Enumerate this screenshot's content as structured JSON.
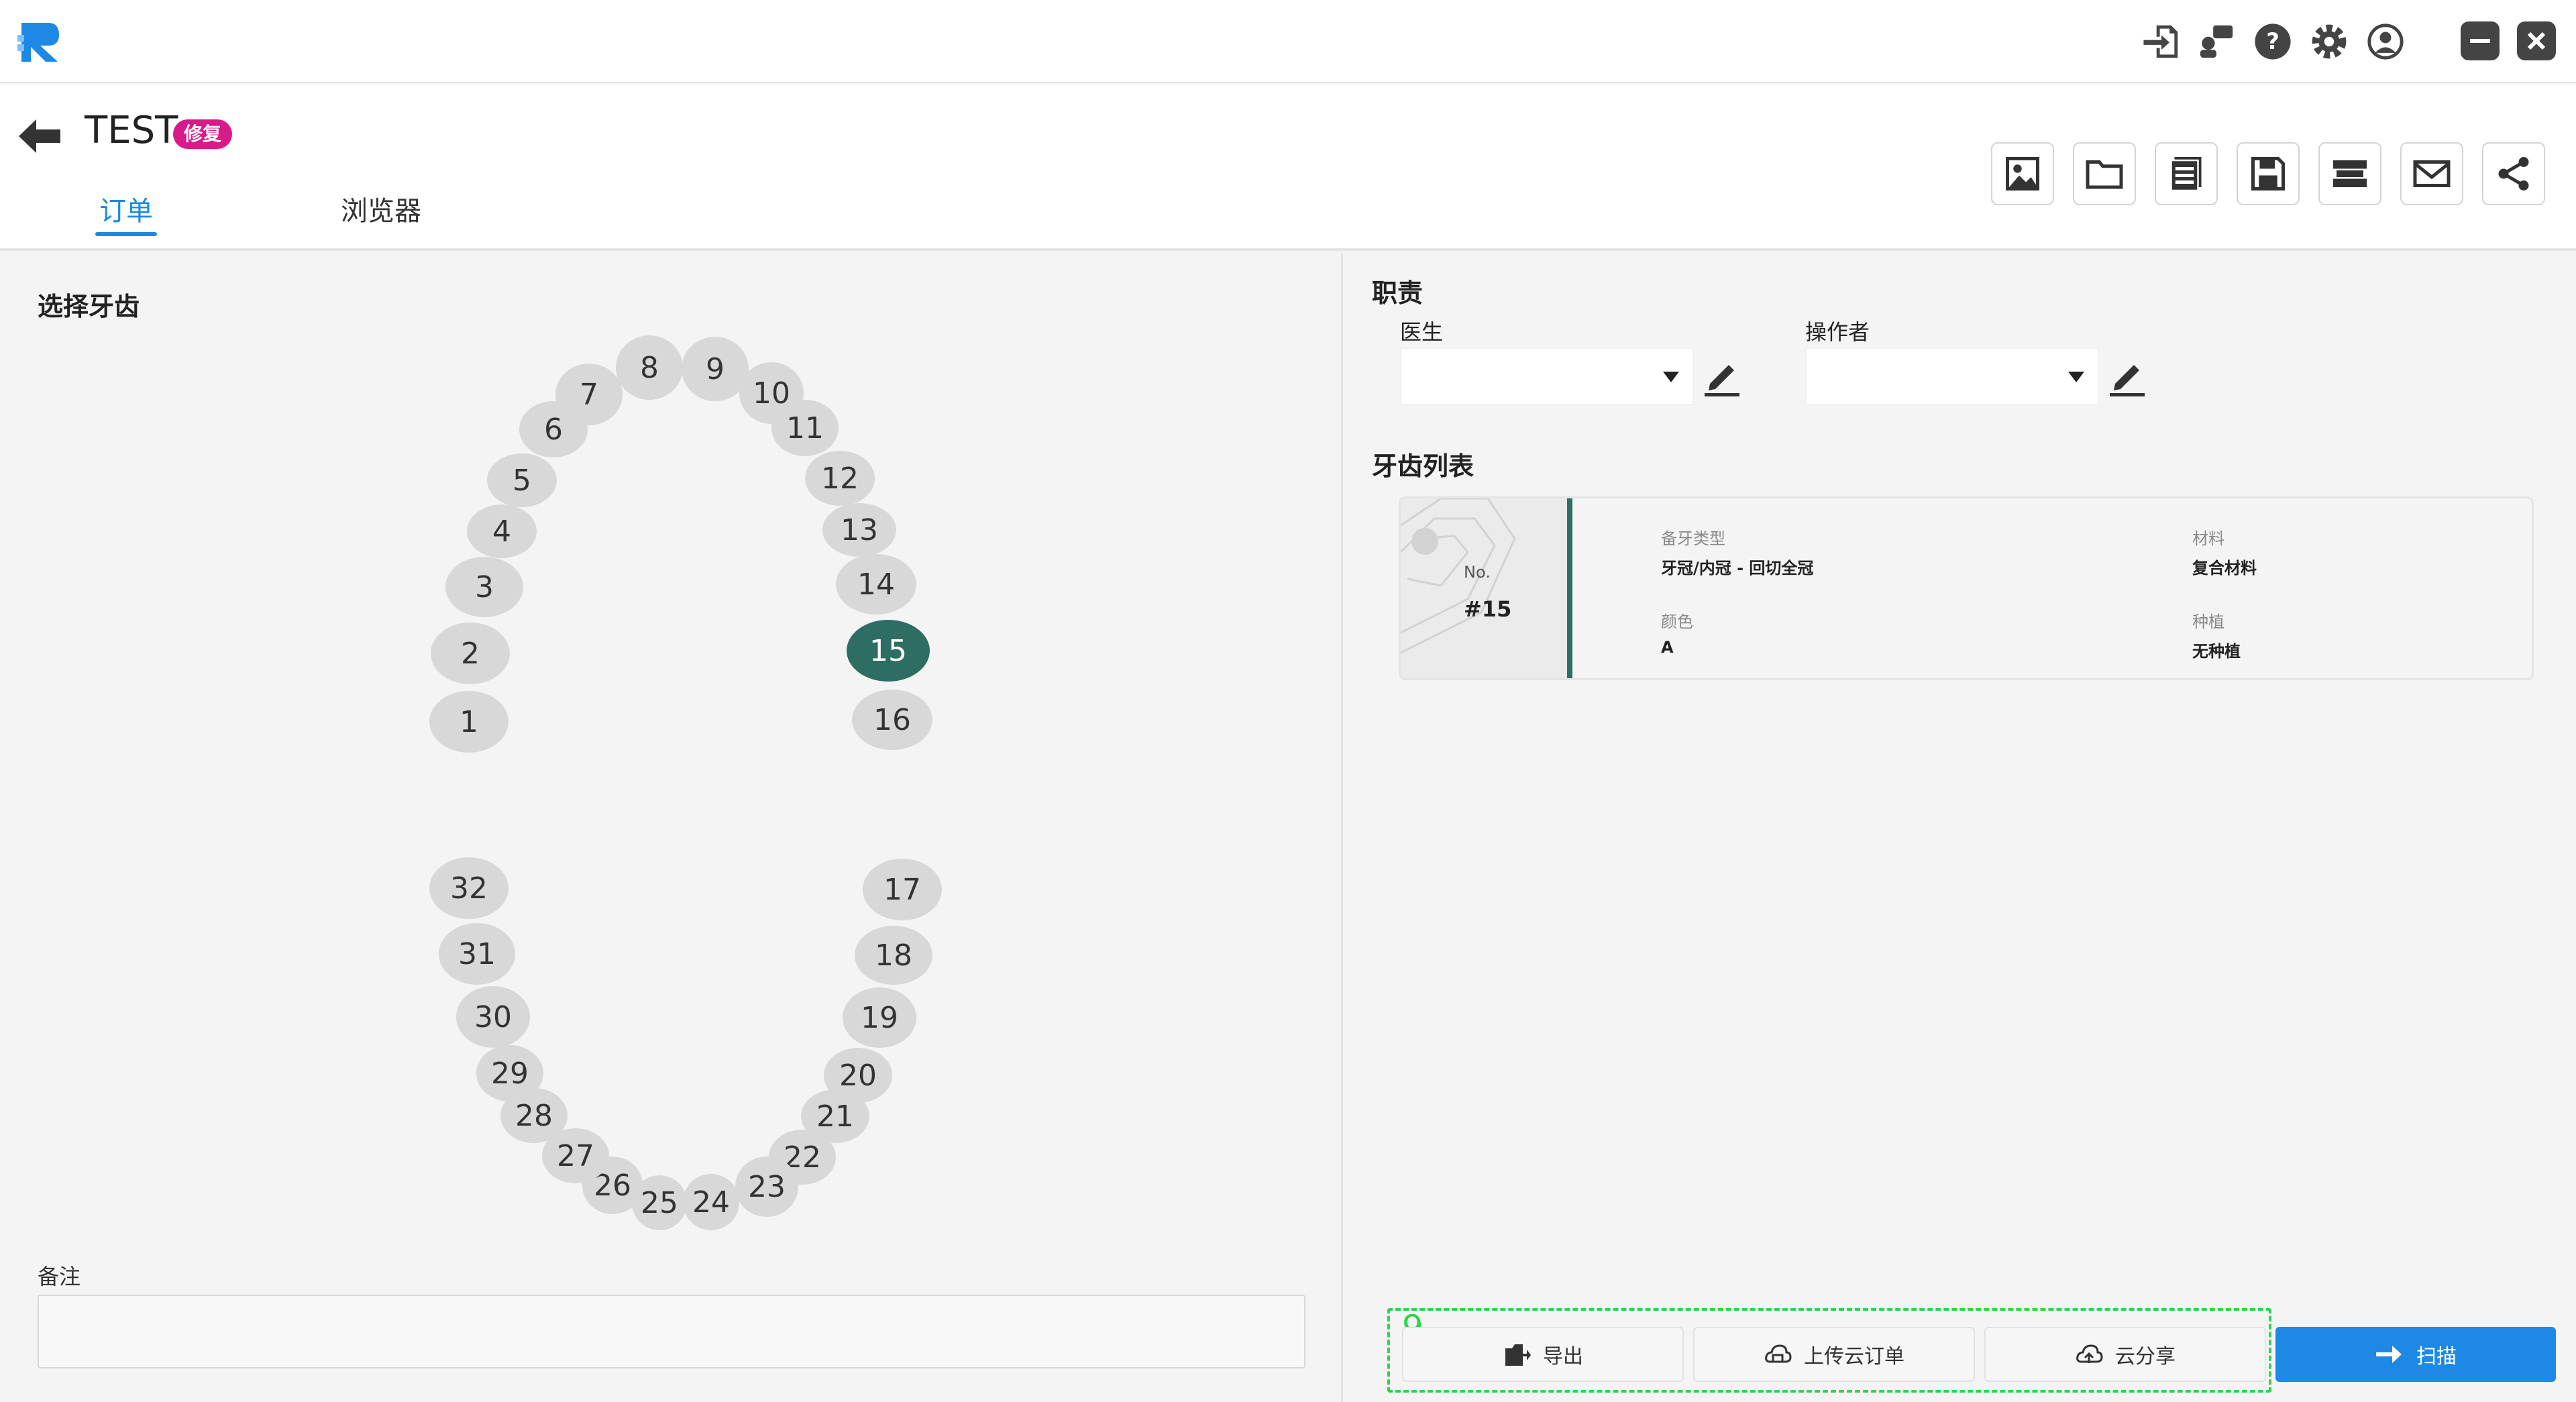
{
  "header": {
    "title": "TEST",
    "badge": "修复",
    "tabs": [
      {
        "label": "订单",
        "active": true
      },
      {
        "label": "浏览器",
        "active": false
      }
    ]
  },
  "left": {
    "select_title": "选择牙齿",
    "notes_label": "备注",
    "notes_value": "",
    "selected_tooth": 15,
    "teeth": [
      "1",
      "2",
      "3",
      "4",
      "5",
      "6",
      "7",
      "8",
      "9",
      "10",
      "11",
      "12",
      "13",
      "14",
      "15",
      "16",
      "17",
      "18",
      "19",
      "20",
      "21",
      "22",
      "23",
      "24",
      "25",
      "26",
      "27",
      "28",
      "29",
      "30",
      "31",
      "32"
    ]
  },
  "right": {
    "responsibility_title": "职责",
    "doctor_label": "医生",
    "doctor_value": "",
    "operator_label": "操作者",
    "operator_value": "",
    "tooth_list_title": "牙齿列表",
    "card": {
      "no_label": "No.",
      "no_value": "#15",
      "type_label": "备牙类型",
      "type_value": "牙冠/内冠 - 回切全冠",
      "material_label": "材料",
      "material_value": "复合材料",
      "color_label": "颜色",
      "color_value": "A",
      "implant_label": "种植",
      "implant_value": "无种植"
    }
  },
  "actions": {
    "group_index": "9",
    "export": "导出",
    "upload": "上传云订单",
    "share": "云分享",
    "scan": "扫描"
  },
  "colors": {
    "accent": "#1e88e5",
    "selected_tooth": "#2e6e62",
    "badge": "#d81b8a",
    "highlight": "#2fd44a"
  }
}
